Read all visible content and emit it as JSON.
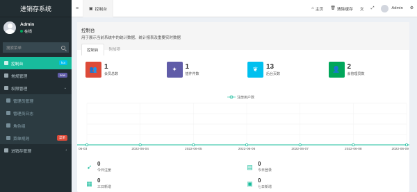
{
  "app": {
    "title": "进销存系统"
  },
  "user": {
    "name": "Admin",
    "status": "在线"
  },
  "search": {
    "placeholder": "搜索菜单"
  },
  "menu": [
    {
      "label": "控制台",
      "badge": "hot"
    },
    {
      "label": "常规管理",
      "badge": "new"
    },
    {
      "label": "权限管理",
      "caret": "⌄"
    },
    {
      "label": "管理员管理"
    },
    {
      "label": "管理员日志"
    },
    {
      "label": "角色组"
    },
    {
      "label": "菜单规则",
      "badge": "菜单"
    },
    {
      "label": "进销存管理",
      "caret": "‹"
    }
  ],
  "topbar": {
    "menu_toggle": "≡",
    "tab_label": "控制台",
    "home_label": "主页",
    "clear_cache_label": "清除缓存",
    "user_name": "Admin"
  },
  "panel": {
    "title": "控制台",
    "description": "用于展示当前系统中的统计数据、统计报表及重要实时数据",
    "tabs": [
      "控制台",
      "附加项"
    ]
  },
  "stats": [
    {
      "value": "1",
      "label": "会员总数",
      "color": "#dd4b39",
      "icon": "users-icon",
      "glyph": "👥"
    },
    {
      "value": "1",
      "label": "插件件数",
      "color": "#605ca8",
      "icon": "magic-icon",
      "glyph": "✦"
    },
    {
      "value": "13",
      "label": "后台页数",
      "color": "#00c0ef",
      "icon": "leaf-icon",
      "glyph": "❦"
    },
    {
      "value": "2",
      "label": "会管理员数",
      "color": "#00a65a",
      "icon": "user-icon",
      "glyph": "👤"
    }
  ],
  "chart_data": {
    "type": "line",
    "legend": "注册用户数",
    "x": [
      "2022-06-03",
      "2022-06-04",
      "2022-06-05",
      "2022-06-06",
      "2022-06-07",
      "2022-06-08",
      "2022-06-09"
    ],
    "x_tick_labels": [
      "06-03",
      "2022-06-04",
      "2022-06-05",
      "2022-06-06",
      "2022-06-07",
      "2022-06-08",
      "2022-06-09"
    ],
    "series": [
      {
        "name": "注册用户数",
        "values": [
          0,
          0,
          0,
          0,
          0,
          0,
          0
        ],
        "color": "#18bc9c"
      }
    ]
  },
  "bottom_stats": [
    {
      "value": "0",
      "label": "今日注册",
      "icon": "rocket-icon",
      "glyph": "🚀"
    },
    {
      "value": "0",
      "label": "今日登录",
      "icon": "vcard-icon",
      "glyph": "▤"
    },
    {
      "value": "0",
      "label": "三日新增",
      "icon": "calendar-icon",
      "glyph": "▦"
    },
    {
      "value": "0",
      "label": "七日新增",
      "icon": "calendar-plus-icon",
      "glyph": "▣"
    }
  ]
}
